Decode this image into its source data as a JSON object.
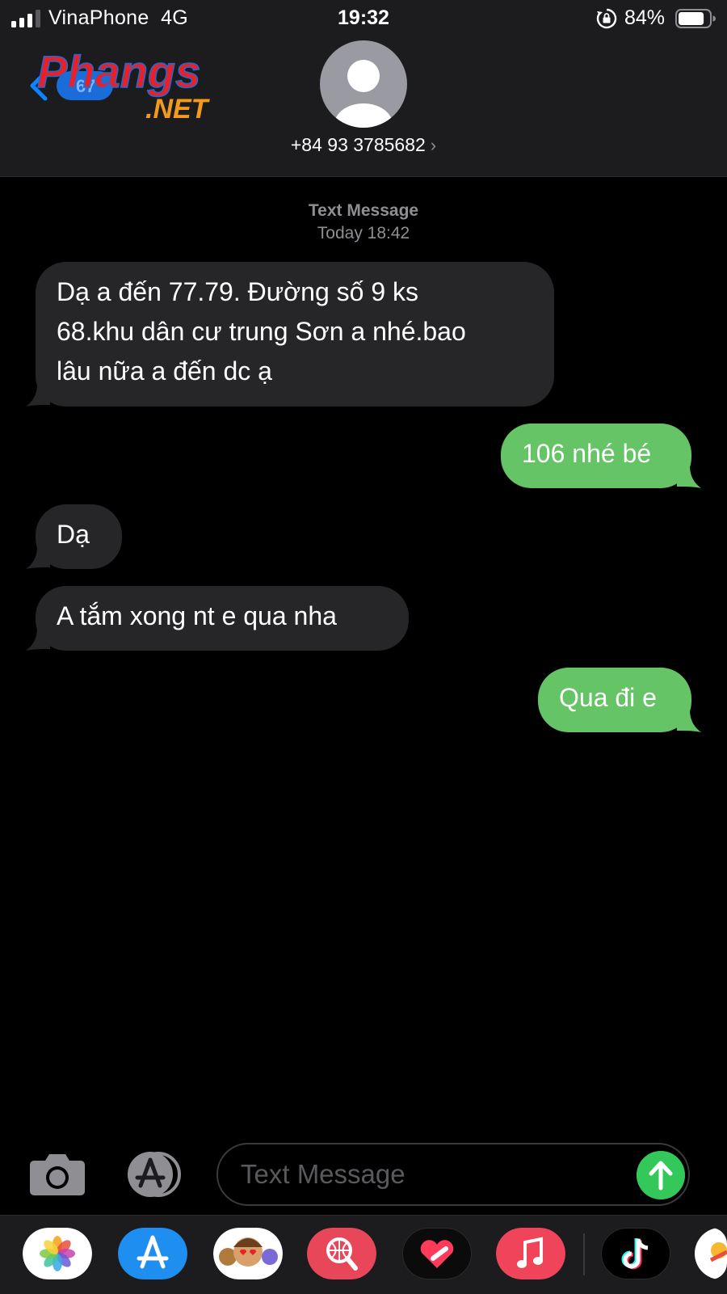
{
  "status_bar": {
    "carrier": "VinaPhone",
    "network": "4G",
    "time": "19:32",
    "battery": "84%",
    "battery_level": 0.84
  },
  "header": {
    "back_badge": "67",
    "logo": {
      "main": "Phangs",
      "sub": ".NET"
    },
    "contact_number": "+84 93 3785682",
    "contact_chevron": "›"
  },
  "thread": {
    "type": "Text Message",
    "date": "Today 18:42",
    "messages": [
      {
        "direction": "incoming",
        "lines": [
          "Dạ a đến 77.79. Đường số 9 ks",
          "68.khu dân cư trung Sơn a nhé.bao",
          "lâu nữa a đến dc ạ"
        ]
      },
      {
        "direction": "outgoing",
        "lines": [
          "106 nhé bé"
        ]
      },
      {
        "direction": "incoming",
        "lines": [
          "Dạ"
        ]
      },
      {
        "direction": "incoming",
        "lines": [
          "A tắm xong nt e qua nha"
        ]
      },
      {
        "direction": "outgoing",
        "lines": [
          "Qua đi e"
        ]
      }
    ]
  },
  "composer": {
    "placeholder": "Text Message"
  },
  "dock": {
    "apps": [
      "photos-icon",
      "app-store-icon",
      "memoji-icon",
      "web-search-icon",
      "health-icon",
      "music-icon",
      "tiktok-icon",
      "maps-icon"
    ]
  },
  "colors": {
    "incoming_bubble": "#262628",
    "outgoing_bubble": "#65c466",
    "send_button": "#34c759",
    "header_bg": "#1c1c1e"
  }
}
